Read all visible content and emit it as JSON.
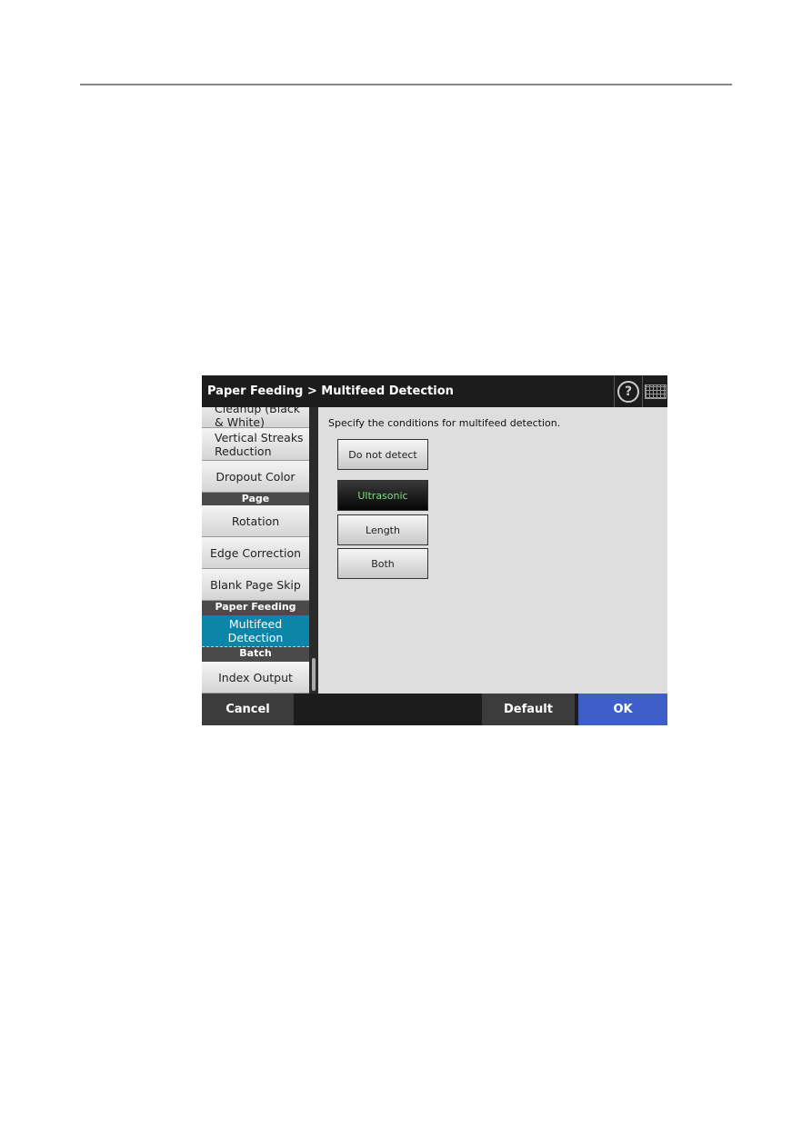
{
  "header": {
    "title": "Paper Feeding > Multifeed Detection",
    "help_icon": "?"
  },
  "sidebar": {
    "items": [
      {
        "label": "Cleanup (Black & White)"
      },
      {
        "label": "Vertical Streaks Reduction"
      },
      {
        "label": "Dropout Color"
      },
      {
        "section": "Page"
      },
      {
        "label": "Rotation"
      },
      {
        "label": "Edge Correction"
      },
      {
        "label": "Blank Page Skip"
      },
      {
        "section": "Paper Feeding"
      },
      {
        "label": "Multifeed Detection",
        "selected": true
      },
      {
        "section": "Batch"
      },
      {
        "label": "Index Output"
      }
    ]
  },
  "content": {
    "prompt": "Specify the conditions for multifeed detection.",
    "options": [
      {
        "label": "Do not detect"
      },
      {
        "label": "Ultrasonic",
        "selected": true
      },
      {
        "label": "Length"
      },
      {
        "label": "Both"
      }
    ]
  },
  "footer": {
    "cancel": "Cancel",
    "default": "Default",
    "ok": "OK"
  },
  "colors": {
    "selected_item": "#0b86a8",
    "ok_button": "#3f5fc8",
    "selected_option_text": "#7fe07f"
  }
}
